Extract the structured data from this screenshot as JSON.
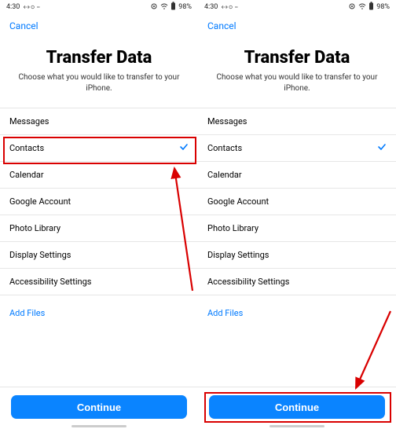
{
  "status": {
    "time": "4:30",
    "battery": "98%"
  },
  "header": {
    "cancel": "Cancel"
  },
  "title": "Transfer Data",
  "subtitle": "Choose what you would like to transfer to your iPhone.",
  "items": [
    {
      "label": "Messages",
      "selected": false
    },
    {
      "label": "Contacts",
      "selected": true
    },
    {
      "label": "Calendar",
      "selected": false
    },
    {
      "label": "Google Account",
      "selected": false
    },
    {
      "label": "Photo Library",
      "selected": false
    },
    {
      "label": "Display Settings",
      "selected": false
    },
    {
      "label": "Accessibility Settings",
      "selected": false
    }
  ],
  "add_files": "Add Files",
  "continue": "Continue",
  "annotations": {
    "left_highlight": "contacts-row",
    "right_highlight": "continue-button",
    "arrows": [
      "left-arrow",
      "right-arrow"
    ],
    "color": "#d90000"
  }
}
